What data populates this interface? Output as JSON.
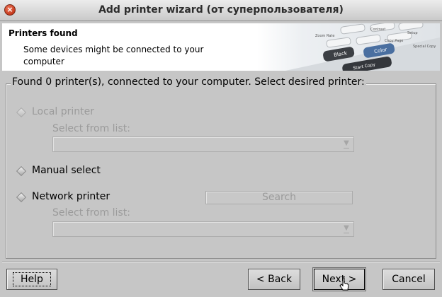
{
  "window": {
    "title": "Add printer wizard (от суперпользователя)",
    "close_icon": "close-icon"
  },
  "header": {
    "title": "Printers found",
    "subtitle": "Some devices might be connected to your computer",
    "art_keys": [
      "Contrast",
      "Zoom Rate",
      "Copy Page",
      "Setup",
      "Special Copy",
      "Black",
      "Color",
      "Start Copy"
    ]
  },
  "group": {
    "title": "Found 0 printer(s), connected to your computer. Select desired printer:",
    "local": {
      "label": "Local printer",
      "select_label": "Select from list:",
      "enabled": false
    },
    "manual": {
      "label": "Manual select",
      "enabled": true
    },
    "network": {
      "label": "Network printer",
      "select_label": "Select from list:",
      "search_label": "Search",
      "enabled": true
    }
  },
  "buttons": {
    "help": "Help",
    "back": "< Back",
    "next": "Next >",
    "cancel": "Cancel"
  },
  "colors": {
    "background": "#c6c6c6",
    "disabled_text": "#9b9b9b",
    "color_key": "#4a6fa0"
  }
}
